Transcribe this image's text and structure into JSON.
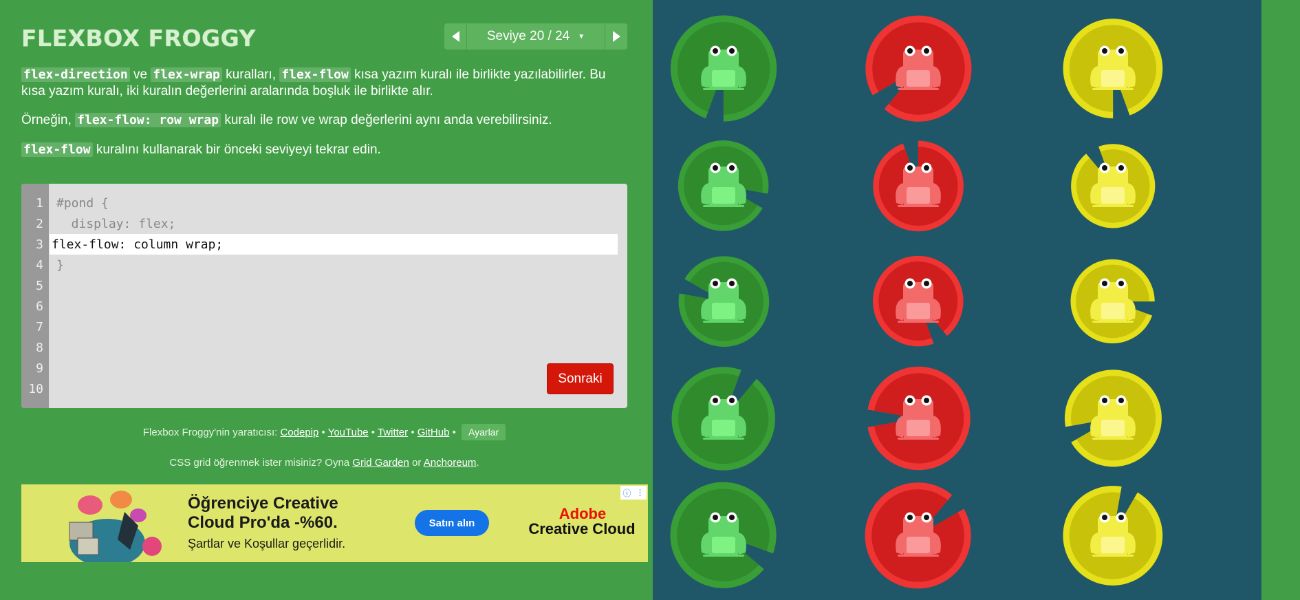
{
  "app": {
    "title": "FLEXBOX FROGGY"
  },
  "level_nav": {
    "indicator": "Seviye 20 / 24",
    "caret": "▼"
  },
  "instructions": {
    "p1": {
      "chip1": "flex-direction",
      "t1": " ve ",
      "chip2": "flex-wrap",
      "t2": " kuralları, ",
      "chip3": "flex-flow",
      "t3": " kısa yazım kuralı ile birlikte yazılabilirler. Bu kısa yazım kuralı, iki kuralın değerlerini aralarında boşluk ile birlikte alır."
    },
    "p2": {
      "t1": "Örneğin, ",
      "chip1": "flex-flow: row wrap",
      "t2": " kuralı ile row ve wrap değerlerini aynı anda verebilirsiniz."
    },
    "p3": {
      "chip1": "flex-flow",
      "t1": " kuralını kullanarak bir önceki seviyeyi tekrar edin."
    }
  },
  "editor": {
    "line_numbers": [
      "1",
      "2",
      "3",
      "4",
      "5",
      "6",
      "7",
      "8",
      "9",
      "10"
    ],
    "line1": "#pond {",
    "line2": "  display: flex;",
    "input_value": "flex-flow: column wrap;",
    "line4": "}",
    "next_label": "Sonraki"
  },
  "credits": {
    "prefix": "Flexbox Froggy'nin yaratıcısı: ",
    "codepip": "Codepip",
    "youtube": "YouTube",
    "twitter": "Twitter",
    "github": "GitHub",
    "sep": " • ",
    "settings": "Ayarlar"
  },
  "promo": {
    "prefix": "CSS grid öğrenmek ister misiniz? Oyna ",
    "grid_garden": "Grid Garden",
    "or": " or ",
    "anchoreum": "Anchoreum",
    "suffix": "."
  },
  "ad": {
    "headline1": "Öğrenciye Creative",
    "headline2": "Cloud Pro'da -%60.",
    "sub": "Şartlar ve Koşullar geçerlidir.",
    "cta": "Satın alın",
    "brand1": "Adobe",
    "brand2": "Creative Cloud",
    "info_icon": "info-icon",
    "menu_icon": "more-icon"
  },
  "pond": {
    "columns": [
      {
        "color": "green",
        "count": 5
      },
      {
        "color": "red",
        "count": 5
      },
      {
        "color": "yellow",
        "count": 5
      }
    ]
  },
  "colors": {
    "background": "#439f47",
    "pond": "#1f5768",
    "green_pad": "#2f8b2c",
    "green_pad_light": "#3a9e37",
    "green_frog": "#62d66b",
    "green_frog_light": "#7ef282",
    "red_pad": "#d01d1d",
    "red_pad_light": "#ef3434",
    "red_frog": "#f36a6a",
    "red_frog_light": "#fb9a9a",
    "yellow_pad": "#c8c20a",
    "yellow_pad_light": "#e5e01a",
    "yellow_frog": "#f3ee45",
    "yellow_frog_light": "#fbf78e",
    "next_button": "#d51709"
  }
}
